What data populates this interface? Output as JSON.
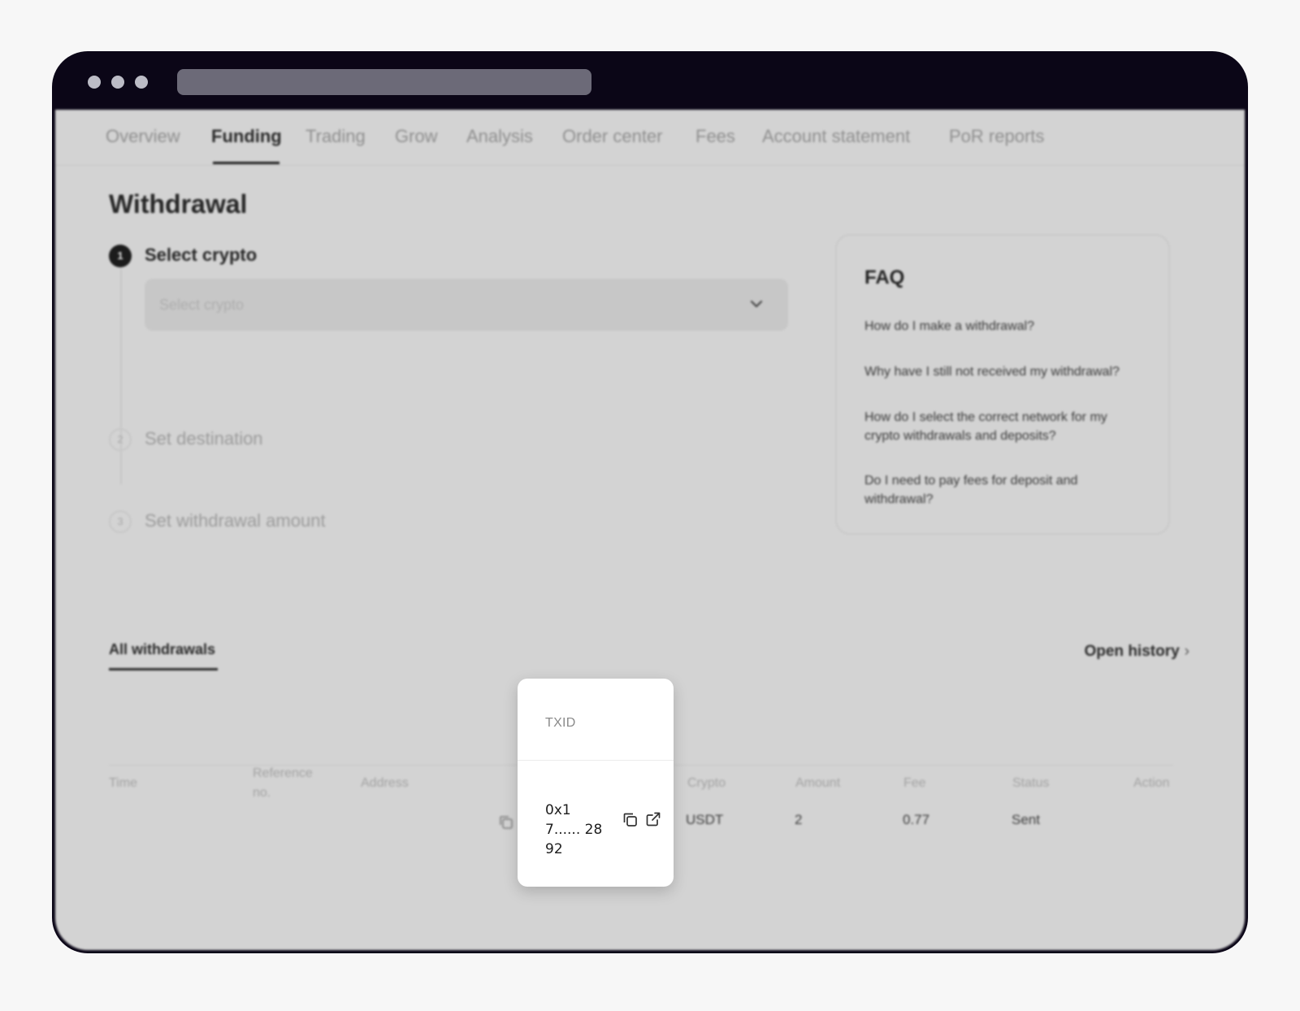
{
  "tabs": [
    {
      "label": "Overview"
    },
    {
      "label": "Funding"
    },
    {
      "label": "Trading"
    },
    {
      "label": "Grow"
    },
    {
      "label": "Analysis"
    },
    {
      "label": "Order center"
    },
    {
      "label": "Fees"
    },
    {
      "label": "Account statement"
    },
    {
      "label": "PoR reports"
    }
  ],
  "active_tab": "Funding",
  "page_title": "Withdrawal",
  "steps": [
    {
      "number": "1",
      "label": "Select crypto"
    },
    {
      "number": "2",
      "label": "Set destination"
    },
    {
      "number": "3",
      "label": "Set withdrawal amount"
    }
  ],
  "select": {
    "placeholder": "Select crypto"
  },
  "faq": {
    "title": "FAQ",
    "items": [
      "How do I make a withdrawal?",
      "Why have I still not received my withdrawal?",
      "How do I select the correct network for my crypto withdrawals and deposits?",
      "Do I need to pay fees for deposit and withdrawal?"
    ]
  },
  "history": {
    "tab_label": "All withdrawals",
    "open_history_label": "Open history",
    "columns": [
      "Time",
      "Reference no.",
      "Address",
      "TXID",
      "Crypto",
      "Amount",
      "Fee",
      "Status",
      "Action"
    ],
    "rows": [
      {
        "crypto": "USDT",
        "amount": "2",
        "fee": "0.77",
        "status": "Sent"
      }
    ]
  },
  "txid_popup": {
    "header": "TXID",
    "value": "0x17...... 2892"
  },
  "icons": {
    "dropdown": "chevron-down-icon",
    "open_history": "chevron-right-icon",
    "copy": "copy-icon",
    "external": "external-link-icon"
  }
}
